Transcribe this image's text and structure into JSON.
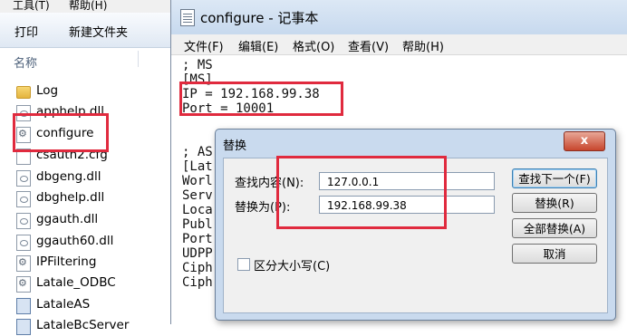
{
  "explorer": {
    "menu": [
      "工具(T)",
      "帮助(H)"
    ],
    "toolbar": [
      "打印",
      "新建文件夹"
    ],
    "column_name": "名称",
    "files": [
      {
        "name": "Log",
        "icon": "folder-icon"
      },
      {
        "name": "apphelp.dll",
        "icon": "dll-file-icon"
      },
      {
        "name": "configure",
        "icon": "config-file-icon"
      },
      {
        "name": "csauth2.cfg",
        "icon": "document-icon"
      },
      {
        "name": "dbgeng.dll",
        "icon": "dll-file-icon"
      },
      {
        "name": "dbghelp.dll",
        "icon": "dll-file-icon"
      },
      {
        "name": "ggauth.dll",
        "icon": "dll-file-icon"
      },
      {
        "name": "ggauth60.dll",
        "icon": "dll-file-icon"
      },
      {
        "name": "IPFiltering",
        "icon": "config-file-icon"
      },
      {
        "name": "Latale_ODBC",
        "icon": "config-file-icon"
      },
      {
        "name": "LataleAS",
        "icon": "exe-file-icon"
      },
      {
        "name": "LataleBcServer",
        "icon": "exe-file-icon"
      }
    ]
  },
  "notepad": {
    "title": "configure - 记事本",
    "menu": [
      "文件(F)",
      "编辑(E)",
      "格式(O)",
      "查看(V)",
      "帮助(H)"
    ],
    "lines": [
      "; MS",
      "[MS]",
      "IP = 192.168.99.38",
      "Port = 10001",
      "",
      "",
      "; AS",
      "[Lat",
      "Worl",
      "Serv",
      "Loca",
      "Publ",
      "Port",
      "UDPP",
      "Ciph",
      "Ciph"
    ]
  },
  "dialog": {
    "title": "替换",
    "close": "x",
    "find_label": "查找内容(N):",
    "find_value": "127.0.0.1",
    "replace_label": "替换为(P):",
    "replace_value": "192.168.99.38",
    "match_case": "区分大小写(C)",
    "buttons": {
      "find_next": "查找下一个(F)",
      "replace": "替换(R)",
      "replace_all": "全部替换(A)",
      "cancel": "取消"
    }
  },
  "colors": {
    "highlight_box": "#e02a3e"
  }
}
